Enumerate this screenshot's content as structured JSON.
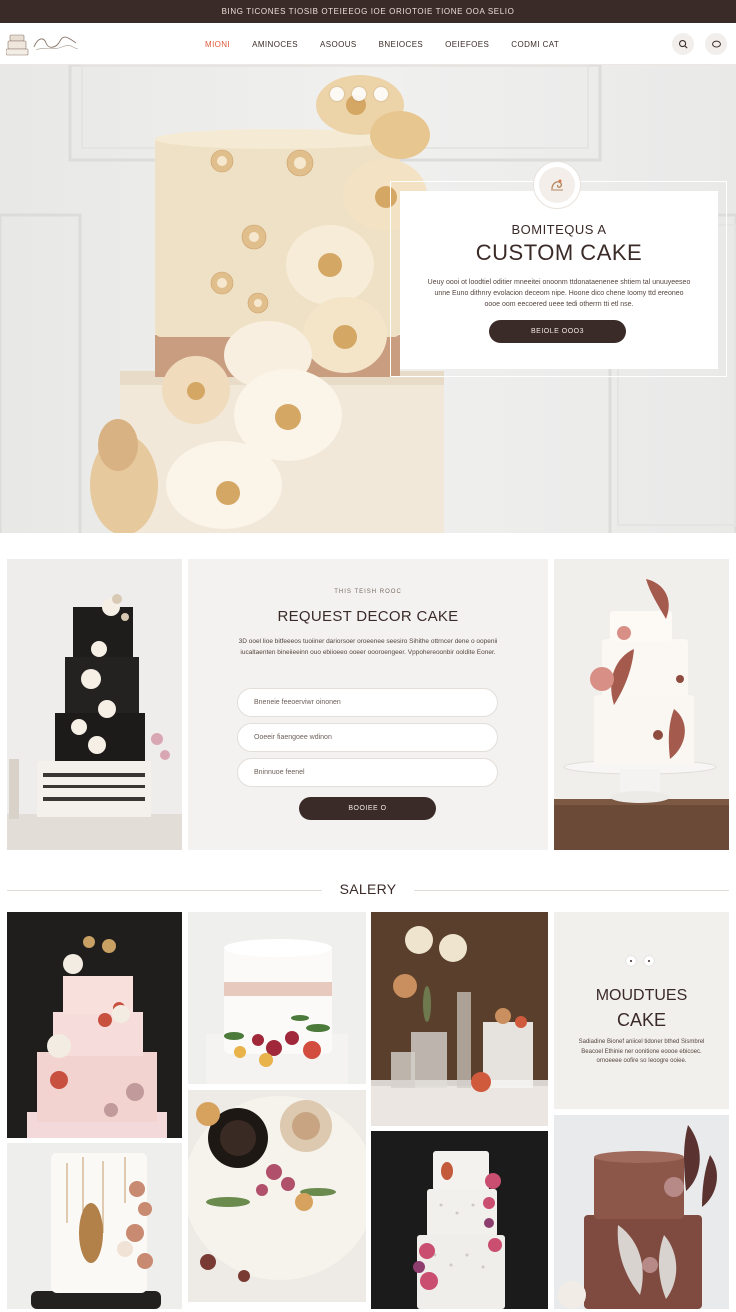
{
  "topbar": {
    "text": "BING TICONES TIOSIB  OTEIEEOG IOE     ORIOTOIE TIONE OOA SELIO"
  },
  "nav": {
    "items": [
      {
        "label": "MIONI",
        "active": true
      },
      {
        "label": "AMINOCES",
        "active": false
      },
      {
        "label": "ASOOUS",
        "active": false
      },
      {
        "label": "BNEIOCES",
        "active": false
      },
      {
        "label": "OEIEFOES",
        "active": false
      },
      {
        "label": "CODMI CAT",
        "active": false
      }
    ],
    "icons": [
      "search-icon",
      "chat-icon"
    ]
  },
  "hero": {
    "eyebrow": "BOMITEQUS A",
    "title": "CUSTOM CAKE",
    "body": "Ueuy oooi ot loodtiel oditier mneeitei onoonm ttdonataenenee shtiem tal unuuyeeseo unne Euno dithnry evolacion deceom nipe. Hoone dico chene Ioomy ttd ereoneo oooe oom eecoered ueee tedi otherrn tti etl nse.",
    "button": "BEIOLE OOO3",
    "accent": "#3b2b28"
  },
  "request": {
    "eyebrow": "THIS TEISH ROOC",
    "title": "REQUEST DECOR CAKE",
    "body": "3D ooel lioe bitfeeeos tuoiiner dariorsoer oroeenee seesiro Sihithe ottrncer dene o oopenii iucaltaenten bineiieeinn ouo ebiioeeo ooeer oooroengeer. Vppohereoonbir ooldite Eoner.",
    "fields": [
      {
        "placeholder": "Bneneie feeoerviwr oinonen"
      },
      {
        "placeholder": "Ooeeir fiaengoee wdinon"
      },
      {
        "placeholder": "Bninnuoe feenel"
      }
    ],
    "button": "BOOIEE O"
  },
  "gallery": {
    "title": "SALERY",
    "promo": {
      "title_line1": "MOUDTUES",
      "title_line2": "CAKE",
      "body": "Sadiadine Bionef aniicel tidoner bthed Sismbrel Beacoel Ethinie ner oonitione eoooe ebicoec. ornoeeee oofire so Ieoogre ooiee."
    }
  },
  "colors": {
    "dark": "#3b2b28",
    "accent": "#e0593a",
    "panel": "#f3f2f0"
  }
}
